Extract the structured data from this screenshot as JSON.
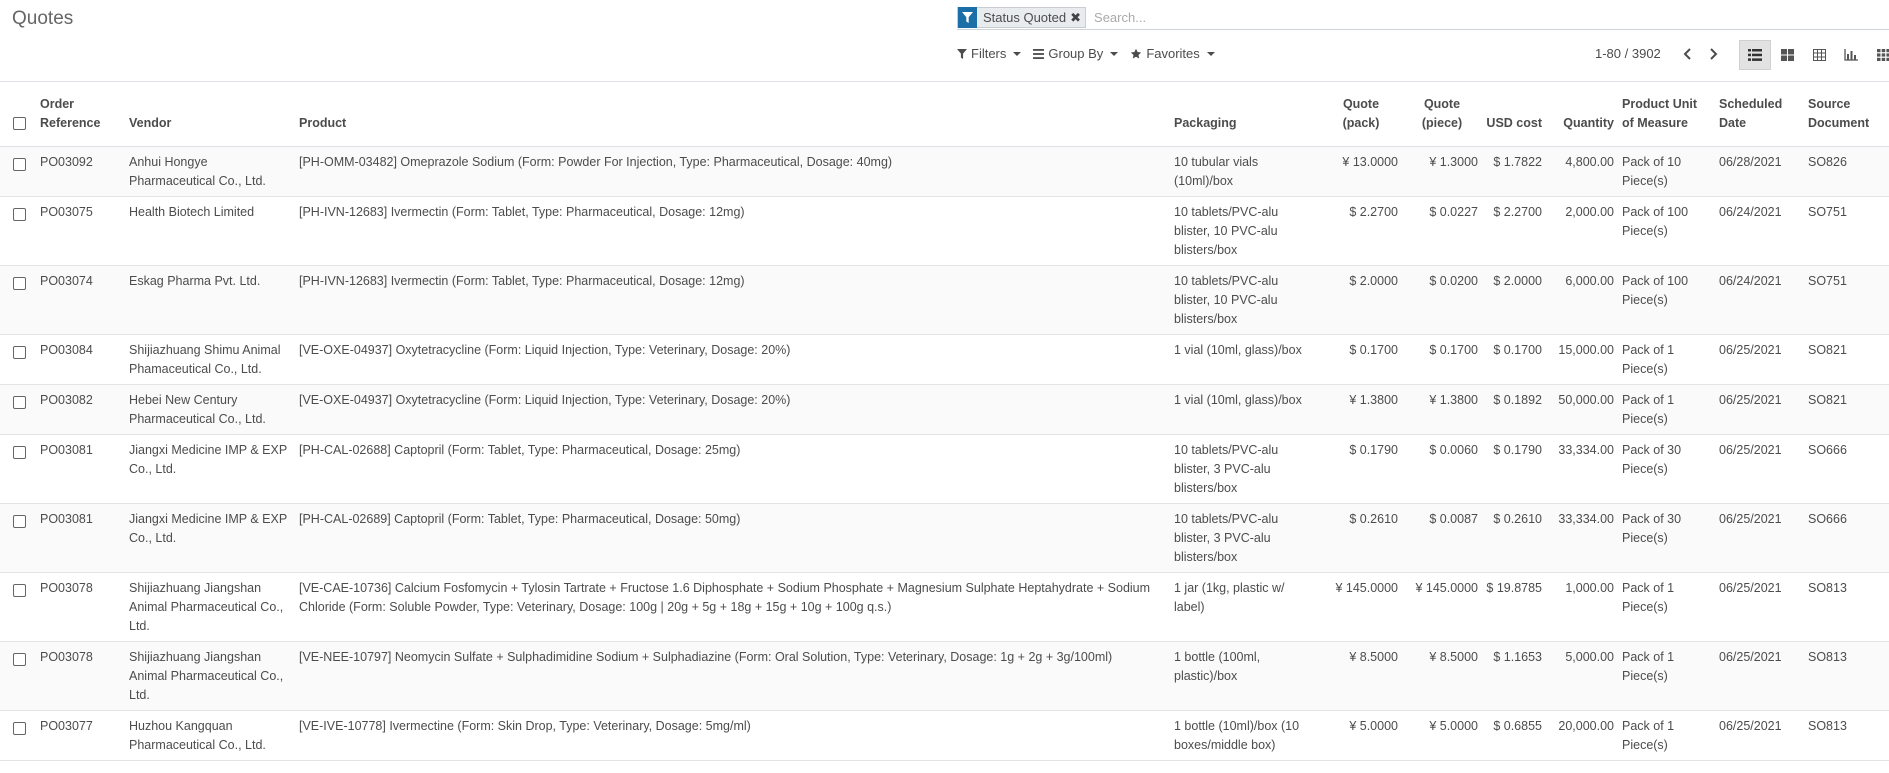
{
  "app": {
    "title": "Quotes"
  },
  "search": {
    "facet_label": "Status Quoted",
    "facet_remove": "✖",
    "placeholder": "Search..."
  },
  "filters": {
    "filters_label": "Filters",
    "group_by_label": "Group By",
    "favorites_label": "Favorites"
  },
  "pager": {
    "value": "1-80 / 3902"
  },
  "views": [
    "list-icon",
    "kanban-icon",
    "pivot-icon",
    "graph-icon",
    "grid-icon"
  ],
  "columns": {
    "order_reference": "Order Reference",
    "vendor": "Vendor",
    "product": "Product",
    "packaging": "Packaging",
    "quote_pack": "Quote (pack)",
    "quote_piece": "Quote (piece)",
    "usd_cost": "USD cost",
    "quantity": "Quantity",
    "uom": "Product Unit of Measure",
    "scheduled_date": "Scheduled Date",
    "source_document": "Source Document"
  },
  "rows": [
    {
      "ref": "PO03092",
      "vendor": "Anhui Hongye Pharmaceutical Co., Ltd.",
      "product": "[PH-OMM-03482] Omeprazole Sodium (Form: Powder For Injection, Type: Pharmaceutical, Dosage: 40mg)",
      "packaging": "10 tubular vials (10ml)/box",
      "quote_pack": "¥ 13.0000",
      "quote_piece": "¥ 1.3000",
      "usd": "$ 1.7822",
      "qty": "4,800.00",
      "uom": "Pack of 10 Piece(s)",
      "date": "06/28/2021",
      "source": "SO826"
    },
    {
      "ref": "PO03075",
      "vendor": "Health Biotech Limited",
      "product": "[PH-IVN-12683] Ivermectin (Form: Tablet, Type: Pharmaceutical, Dosage: 12mg)",
      "packaging": "10 tablets/PVC-alu blister, 10 PVC-alu blisters/box",
      "quote_pack": "$ 2.2700",
      "quote_piece": "$ 0.0227",
      "usd": "$ 2.2700",
      "qty": "2,000.00",
      "uom": "Pack of 100 Piece(s)",
      "date": "06/24/2021",
      "source": "SO751"
    },
    {
      "ref": "PO03074",
      "vendor": "Eskag Pharma Pvt. Ltd.",
      "product": "[PH-IVN-12683] Ivermectin (Form: Tablet, Type: Pharmaceutical, Dosage: 12mg)",
      "packaging": "10 tablets/PVC-alu blister, 10 PVC-alu blisters/box",
      "quote_pack": "$ 2.0000",
      "quote_piece": "$ 0.0200",
      "usd": "$ 2.0000",
      "qty": "6,000.00",
      "uom": "Pack of 100 Piece(s)",
      "date": "06/24/2021",
      "source": "SO751"
    },
    {
      "ref": "PO03084",
      "vendor": "Shijiazhuang Shimu Animal Phamaceutical Co., Ltd.",
      "product": "[VE-OXE-04937] Oxytetracycline (Form: Liquid Injection, Type: Veterinary, Dosage: 20%)",
      "packaging": "1 vial (10ml, glass)/box",
      "quote_pack": "$ 0.1700",
      "quote_piece": "$ 0.1700",
      "usd": "$ 0.1700",
      "qty": "15,000.00",
      "uom": "Pack of 1 Piece(s)",
      "date": "06/25/2021",
      "source": "SO821"
    },
    {
      "ref": "PO03082",
      "vendor": "Hebei New Century Pharmaceutical Co., Ltd.",
      "product": "[VE-OXE-04937] Oxytetracycline (Form: Liquid Injection, Type: Veterinary, Dosage: 20%)",
      "packaging": "1 vial (10ml, glass)/box",
      "quote_pack": "¥ 1.3800",
      "quote_piece": "¥ 1.3800",
      "usd": "$ 0.1892",
      "qty": "50,000.00",
      "uom": "Pack of 1 Piece(s)",
      "date": "06/25/2021",
      "source": "SO821"
    },
    {
      "ref": "PO03081",
      "vendor": "Jiangxi Medicine IMP & EXP Co., Ltd.",
      "product": "[PH-CAL-02688] Captopril (Form: Tablet, Type: Pharmaceutical, Dosage: 25mg)",
      "packaging": "10 tablets/PVC-alu blister, 3 PVC-alu blisters/box",
      "quote_pack": "$ 0.1790",
      "quote_piece": "$ 0.0060",
      "usd": "$ 0.1790",
      "qty": "33,334.00",
      "uom": "Pack of 30 Piece(s)",
      "date": "06/25/2021",
      "source": "SO666"
    },
    {
      "ref": "PO03081",
      "vendor": "Jiangxi Medicine IMP & EXP Co., Ltd.",
      "product": "[PH-CAL-02689] Captopril (Form: Tablet, Type: Pharmaceutical, Dosage: 50mg)",
      "packaging": "10 tablets/PVC-alu blister, 3 PVC-alu blisters/box",
      "quote_pack": "$ 0.2610",
      "quote_piece": "$ 0.0087",
      "usd": "$ 0.2610",
      "qty": "33,334.00",
      "uom": "Pack of 30 Piece(s)",
      "date": "06/25/2021",
      "source": "SO666"
    },
    {
      "ref": "PO03078",
      "vendor": "Shijiazhuang Jiangshan Animal Pharmaceutical Co., Ltd.",
      "product": "[VE-CAE-10736] Calcium Fosfomycin + Tylosin Tartrate + Fructose 1.6 Diphosphate + Sodium Phosphate + Magnesium Sulphate Heptahydrate + Sodium Chloride (Form: Soluble Powder, Type: Veterinary, Dosage: 100g | 20g + 5g + 18g + 15g + 10g + 100g q.s.)",
      "packaging": "1 jar (1kg, plastic w/ label)",
      "quote_pack": "¥ 145.0000",
      "quote_piece": "¥ 145.0000",
      "usd": "$ 19.8785",
      "qty": "1,000.00",
      "uom": "Pack of 1 Piece(s)",
      "date": "06/25/2021",
      "source": "SO813"
    },
    {
      "ref": "PO03078",
      "vendor": "Shijiazhuang Jiangshan Animal Pharmaceutical Co., Ltd.",
      "product": "[VE-NEE-10797] Neomycin Sulfate + Sulphadimidine Sodium + Sulphadiazine (Form: Oral Solution, Type: Veterinary, Dosage: 1g + 2g + 3g/100ml)",
      "packaging": "1 bottle (100ml, plastic)/box",
      "quote_pack": "¥ 8.5000",
      "quote_piece": "¥ 8.5000",
      "usd": "$ 1.1653",
      "qty": "5,000.00",
      "uom": "Pack of 1 Piece(s)",
      "date": "06/25/2021",
      "source": "SO813"
    },
    {
      "ref": "PO03077",
      "vendor": "Huzhou Kangquan Pharmaceutical Co., Ltd.",
      "product": "[VE-IVE-10778] Ivermectine (Form: Skin Drop, Type: Veterinary, Dosage: 5mg/ml)",
      "packaging": "1 bottle (10ml)/box (10 boxes/middle box)",
      "quote_pack": "¥ 5.0000",
      "quote_piece": "¥ 5.0000",
      "usd": "$ 0.6855",
      "qty": "20,000.00",
      "uom": "Pack of 1 Piece(s)",
      "date": "06/25/2021",
      "source": "SO813"
    }
  ],
  "colors": {
    "facet_blue": "#1b6fa6",
    "text": "#4c4c4c",
    "border": "#dee2e6"
  }
}
